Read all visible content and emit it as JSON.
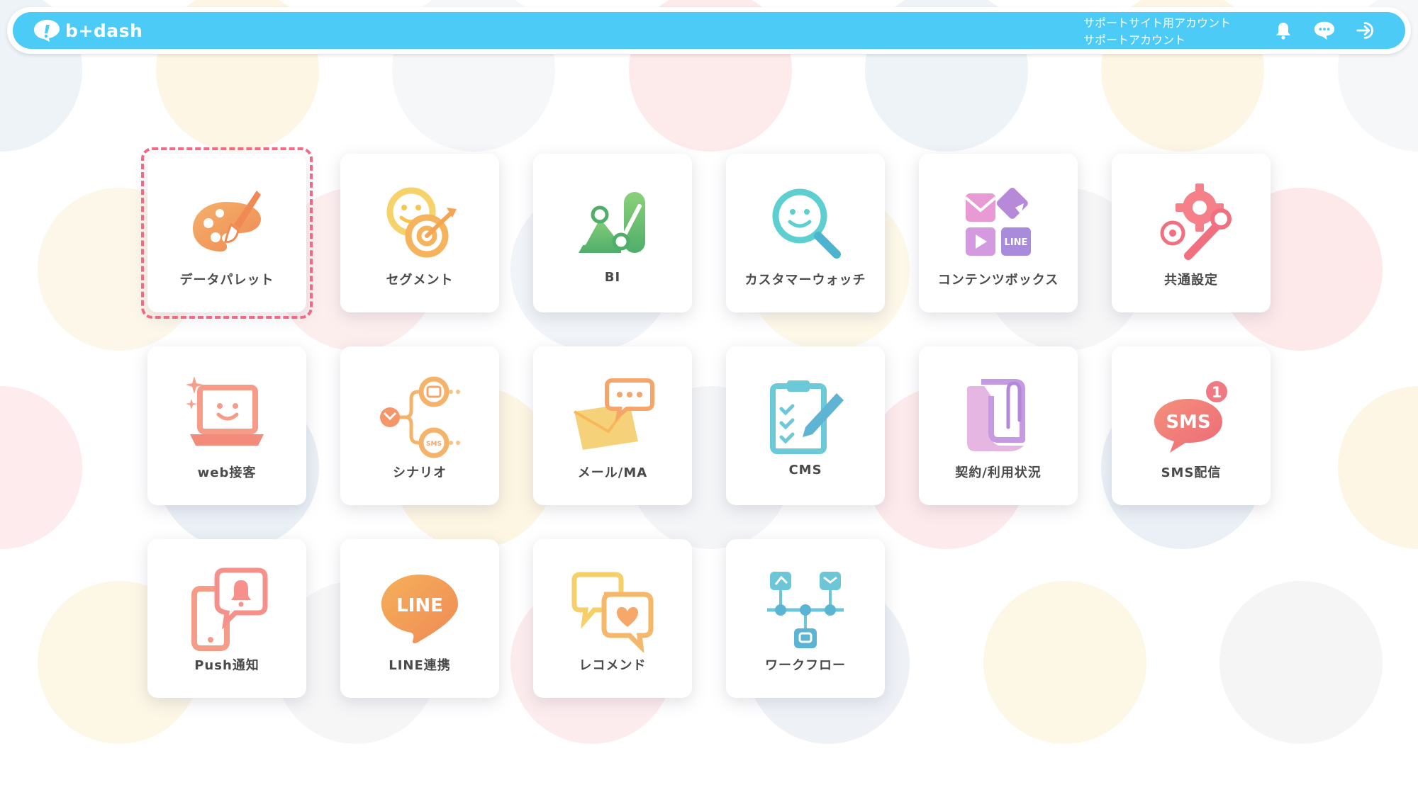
{
  "header": {
    "logo_text": "b+dash",
    "account_line1": "サポートサイト用アカウント",
    "account_line2": "サポートアカウント",
    "icons": [
      "bell-icon",
      "chat-bubble-icon",
      "logout-icon"
    ]
  },
  "colors": {
    "header_bg": "#4ccbf6",
    "selection_border": "#f06a86",
    "label_text": "#4a4a4a"
  },
  "apps": [
    {
      "label": "データパレット",
      "icon": "paint-palette-icon",
      "selected": true
    },
    {
      "label": "セグメント",
      "icon": "smiley-target-icon"
    },
    {
      "label": "BI",
      "icon": "chart-analytics-icon"
    },
    {
      "label": "カスタマーウォッチ",
      "icon": "smiley-magnifier-icon"
    },
    {
      "label": "コンテンツボックス",
      "icon": "content-blocks-icon"
    },
    {
      "label": "共通設定",
      "icon": "gear-wrench-icon"
    },
    {
      "label": "web接客",
      "icon": "laptop-smile-icon"
    },
    {
      "label": "シナリオ",
      "icon": "scenario-flow-icon"
    },
    {
      "label": "メール/MA",
      "icon": "envelope-chat-icon"
    },
    {
      "label": "CMS",
      "icon": "clipboard-pencil-icon"
    },
    {
      "label": "契約/利用状況",
      "icon": "documents-clip-icon"
    },
    {
      "label": "SMS配信",
      "icon": "sms-bubble-icon"
    },
    {
      "label": "Push通知",
      "icon": "phone-bell-icon"
    },
    {
      "label": "LINE連携",
      "icon": "line-bubble-icon"
    },
    {
      "label": "レコメンド",
      "icon": "chat-heart-icon"
    },
    {
      "label": "ワークフロー",
      "icon": "workflow-nodes-icon"
    }
  ],
  "line_text": "LINE",
  "sms_text": "SMS",
  "sms_badge": "1"
}
